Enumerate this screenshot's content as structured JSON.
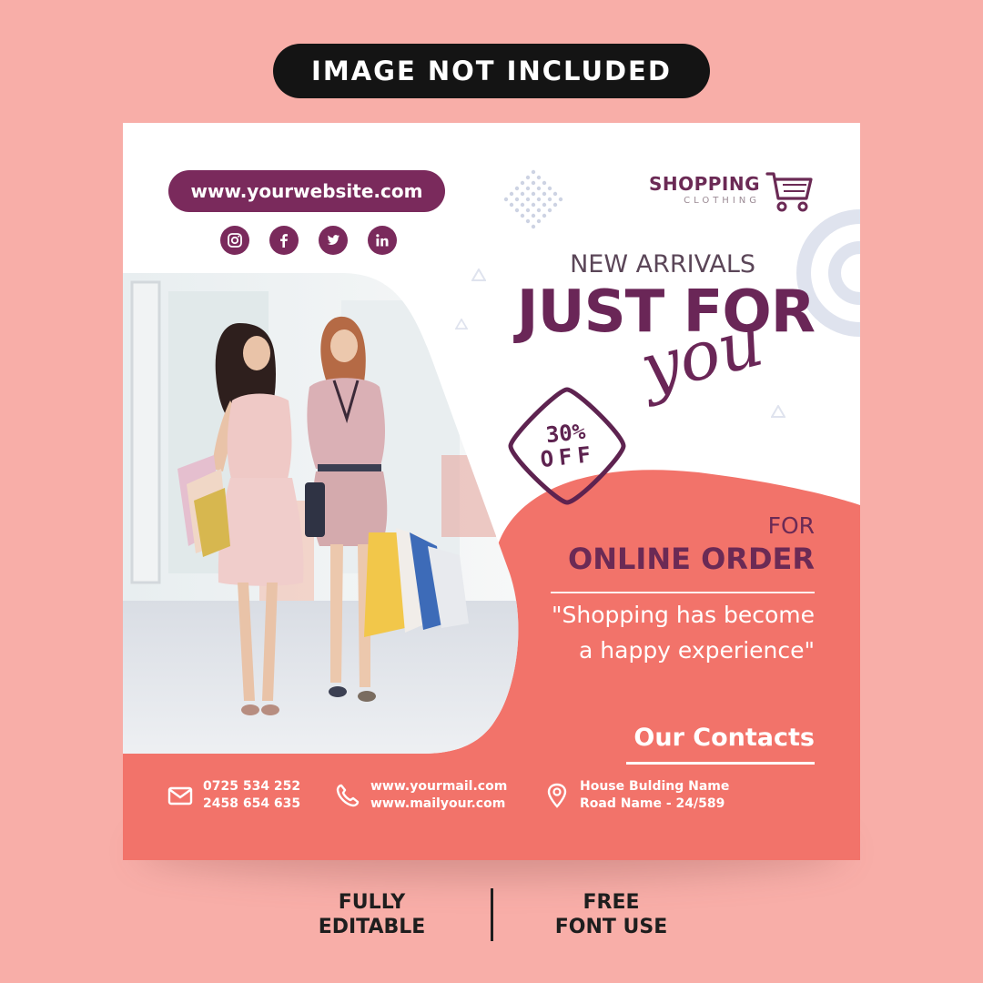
{
  "banner": {
    "label": "IMAGE NOT INCLUDED"
  },
  "header": {
    "website": "www.yourwebsite.com",
    "brand_main": "SHOPPING",
    "brand_sub": "CLOTHING",
    "socials": [
      "instagram-icon",
      "facebook-icon",
      "twitter-icon",
      "linkedin-icon"
    ]
  },
  "headline": {
    "new_arrivals": "NEW ARRIVALS",
    "just_for": "JUST FOR",
    "you": "you"
  },
  "discount": {
    "percent": "30%",
    "off": "OFF"
  },
  "offer": {
    "for": "FOR",
    "online_order": "ONLINE ORDER",
    "quote_line1": "\"Shopping has become",
    "quote_line2": "a happy experience\""
  },
  "contacts": {
    "title": "Our Contacts",
    "phone_line1": "0725 534 252",
    "phone_line2": "2458 654 635",
    "mail_line1": "www.yourmail.com",
    "mail_line2": "www.mailyour.com",
    "address_line1": "House Bulding Name",
    "address_line2": "Road Name - 24/589"
  },
  "features": {
    "left_line1": "FULLY",
    "left_line2": "EDITABLE",
    "right_line1": "FREE",
    "right_line2": "FONT USE"
  },
  "colors": {
    "background": "#f8aea8",
    "coral": "#f2736a",
    "plum": "#6a2657",
    "white": "#ffffff"
  }
}
